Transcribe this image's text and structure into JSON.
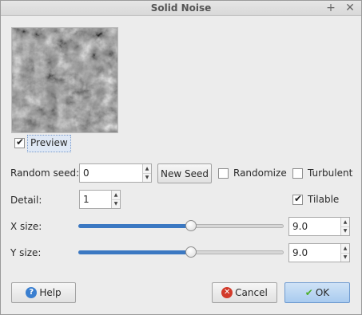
{
  "window": {
    "title": "Solid Noise",
    "pin_icon": "+",
    "close_icon": "✕"
  },
  "preview": {
    "label": "Preview",
    "checked": true
  },
  "random_seed": {
    "label": "Random seed:",
    "value": "0",
    "new_seed_label": "New Seed"
  },
  "options": {
    "randomize_label": "Randomize",
    "randomize_checked": false,
    "turbulent_label": "Turbulent",
    "turbulent_checked": false,
    "tilable_label": "Tilable",
    "tilable_checked": true
  },
  "detail": {
    "label": "Detail:",
    "value": "1"
  },
  "x_size": {
    "label": "X size:",
    "value": "9.0",
    "slider_fraction": 0.55
  },
  "y_size": {
    "label": "Y size:",
    "value": "9.0",
    "slider_fraction": 0.55
  },
  "buttons": {
    "help_label": "Help",
    "cancel_label": "Cancel",
    "ok_label": "OK"
  },
  "colors": {
    "slider_fill": "#3b78c2",
    "help_icon": "#3a7fd0",
    "cancel_icon": "#d23a2a",
    "ok_check": "#4caf2a"
  }
}
